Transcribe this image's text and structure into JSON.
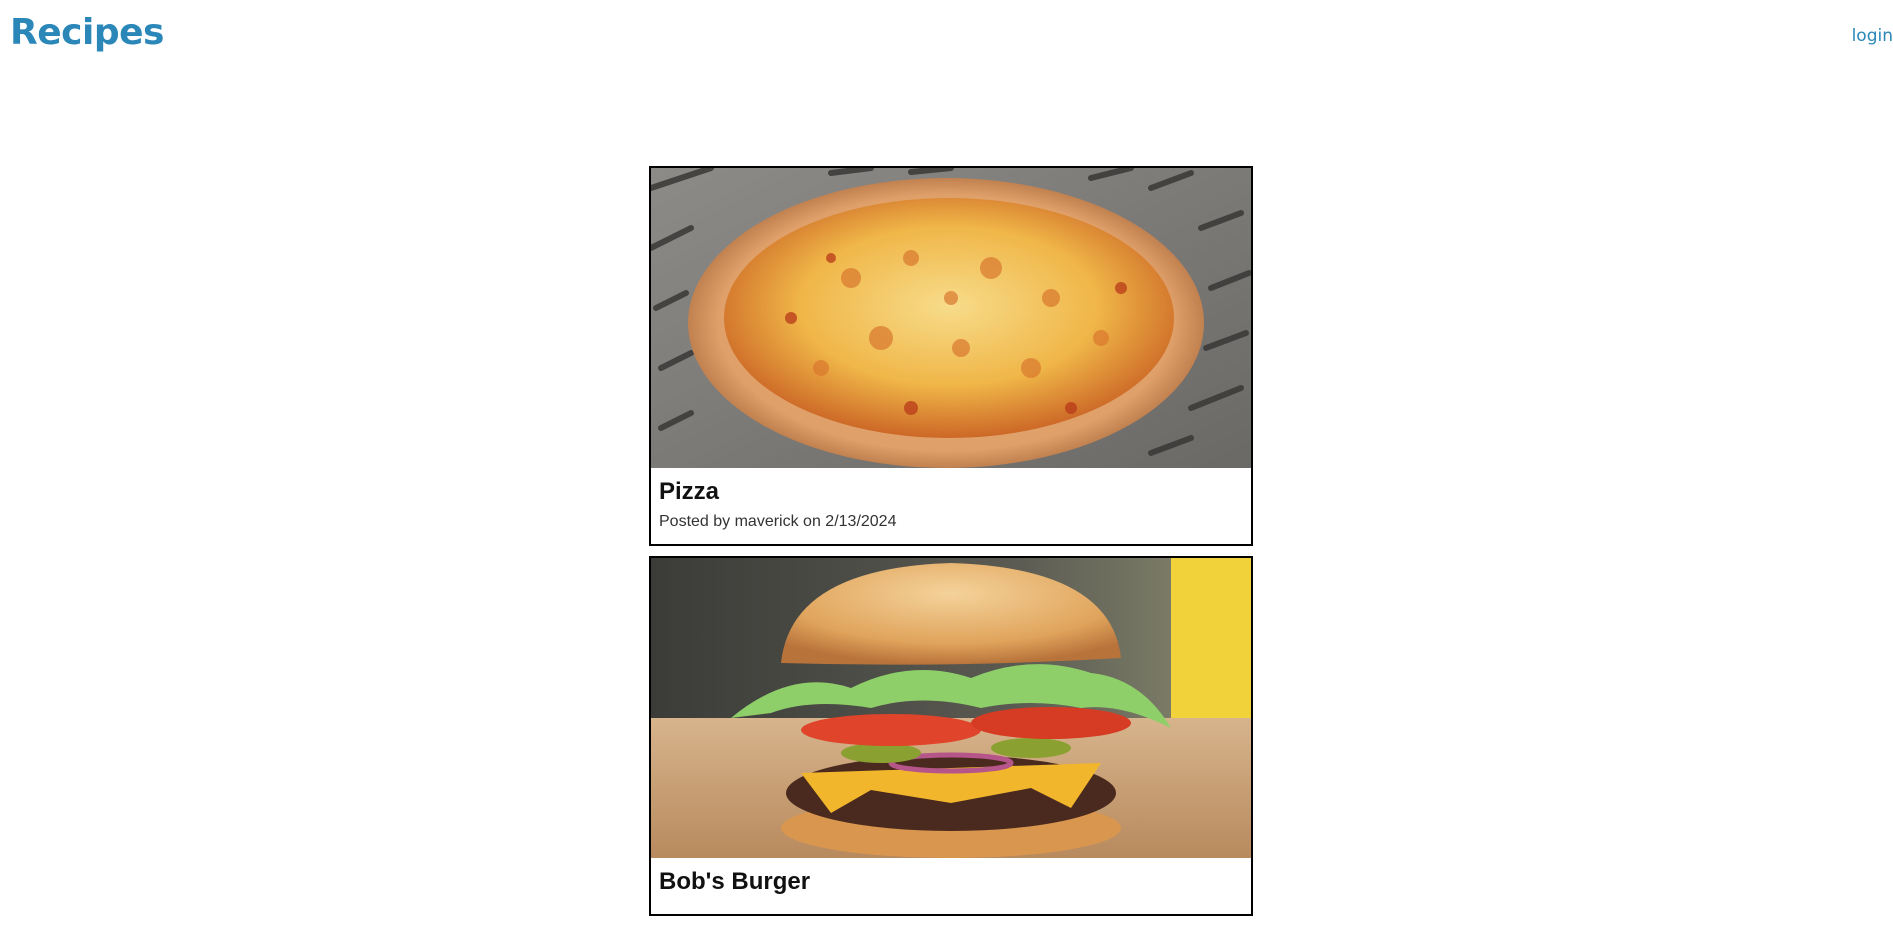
{
  "header": {
    "brand": "Recipes",
    "login_label": "login"
  },
  "accent_color": "#2a87b8",
  "recipes": [
    {
      "title": "Pizza",
      "meta": "Posted by maverick on 2/13/2024",
      "image": "pizza-photo"
    },
    {
      "title": "Bob's Burger",
      "meta": "",
      "image": "burger-photo"
    }
  ]
}
